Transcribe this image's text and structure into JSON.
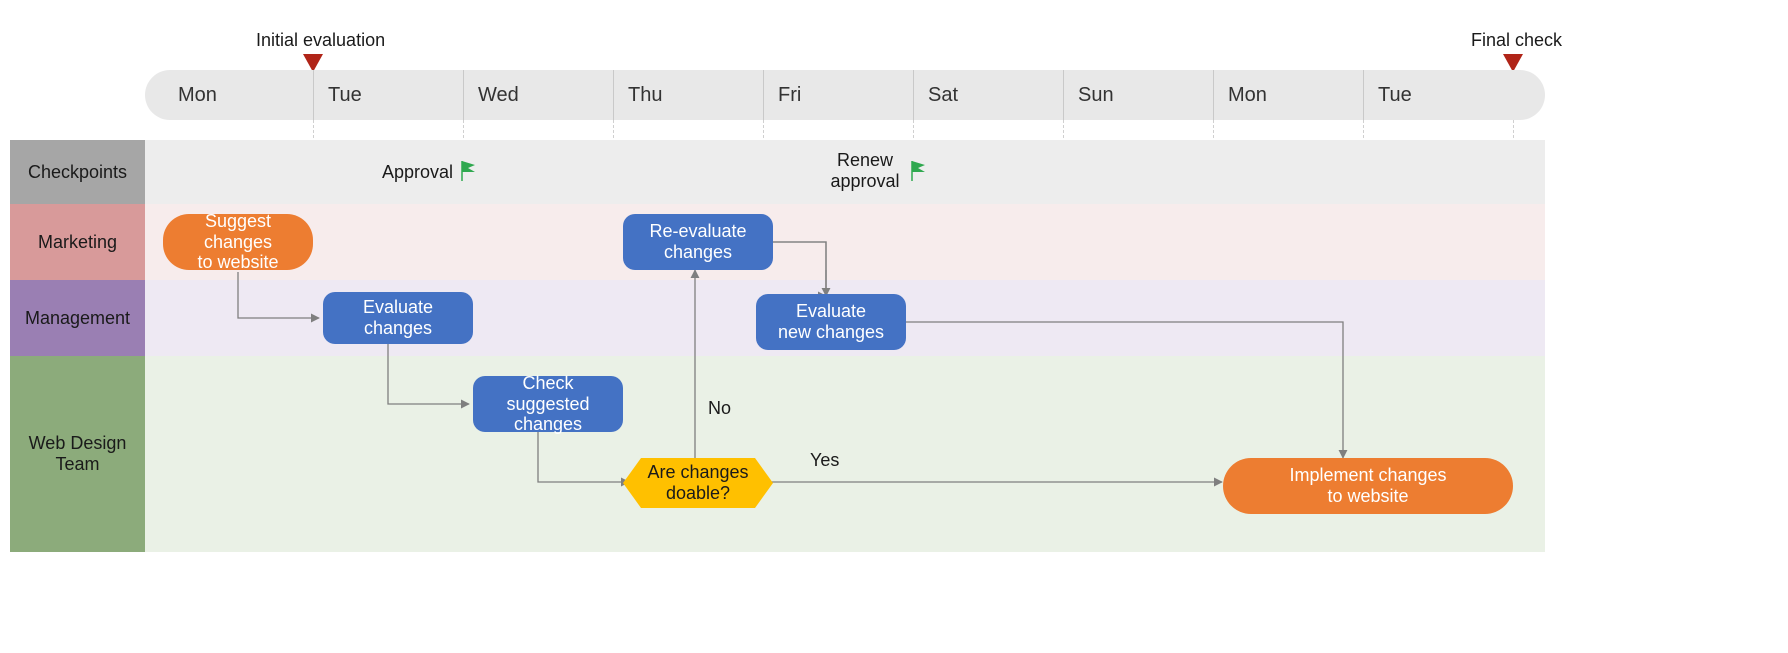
{
  "milestones": {
    "initial": "Initial evaluation",
    "final": "Final check"
  },
  "days": [
    "Mon",
    "Tue",
    "Wed",
    "Thu",
    "Fri",
    "Sat",
    "Sun",
    "Mon",
    "Tue"
  ],
  "lanes": {
    "checkpoints": "Checkpoints",
    "marketing": "Marketing",
    "management": "Management",
    "webdesign": "Web Design\nTeam"
  },
  "checkpoints": {
    "approval": "Approval",
    "renew": "Renew\napproval"
  },
  "nodes": {
    "suggest": "Suggest changes\nto website",
    "evaluate": "Evaluate changes",
    "check": "Check suggested\nchanges",
    "decision": "Are changes\ndoable?",
    "reevaluate": "Re-evaluate\nchanges",
    "evaluate_new": "Evaluate\nnew changes",
    "implement": "Implement changes\nto website"
  },
  "edge_labels": {
    "no": "No",
    "yes": "Yes"
  },
  "colors": {
    "orange": "#ed7d31",
    "blue": "#4472c4",
    "gold": "#ffc000",
    "lane_checkpoints_title": "#a6a6a6",
    "lane_checkpoints_band": "#ededed",
    "lane_marketing_title": "#d89a9a",
    "lane_marketing_band": "#f7ecec",
    "lane_management_title": "#9a7fb3",
    "lane_management_band": "#eee9f3",
    "lane_web_title": "#8cab7b",
    "lane_web_band": "#eaf1e6",
    "flag": "#2fa84f",
    "marker": "#b02418"
  },
  "chart_data": {
    "type": "swimlane-flow",
    "time_axis": [
      "Mon",
      "Tue",
      "Wed",
      "Thu",
      "Fri",
      "Sat",
      "Sun",
      "Mon",
      "Tue"
    ],
    "milestones": [
      {
        "label": "Initial evaluation",
        "at": "Tue(1)"
      },
      {
        "label": "Final check",
        "at": "Tue(2)"
      }
    ],
    "lanes": [
      "Checkpoints",
      "Marketing",
      "Management",
      "Web Design Team"
    ],
    "checkpoint_flags": [
      {
        "label": "Approval",
        "lane": "Checkpoints",
        "near_day": "Wed"
      },
      {
        "label": "Renew approval",
        "lane": "Checkpoints",
        "near_day": "Sat"
      }
    ],
    "nodes": [
      {
        "id": "suggest",
        "label": "Suggest changes to website",
        "lane": "Marketing",
        "day": "Mon",
        "shape": "rounded-rect",
        "color": "orange"
      },
      {
        "id": "evaluate",
        "label": "Evaluate changes",
        "lane": "Management",
        "day": "Tue",
        "shape": "rounded-rect",
        "color": "blue"
      },
      {
        "id": "check",
        "label": "Check suggested changes",
        "lane": "Web Design Team",
        "day": "Wed",
        "shape": "rounded-rect",
        "color": "blue"
      },
      {
        "id": "decision",
        "label": "Are changes doable?",
        "lane": "Web Design Team",
        "day": "Thu",
        "shape": "hexagon",
        "color": "gold"
      },
      {
        "id": "reevaluate",
        "label": "Re-evaluate changes",
        "lane": "Marketing",
        "day": "Thu",
        "shape": "rounded-rect",
        "color": "blue"
      },
      {
        "id": "evaluate_new",
        "label": "Evaluate new changes",
        "lane": "Management",
        "day": "Fri",
        "shape": "rounded-rect",
        "color": "blue"
      },
      {
        "id": "implement",
        "label": "Implement changes to website",
        "lane": "Web Design Team",
        "day": "Tue(2)",
        "shape": "pill",
        "color": "orange"
      }
    ],
    "edges": [
      {
        "from": "suggest",
        "to": "evaluate"
      },
      {
        "from": "evaluate",
        "to": "check"
      },
      {
        "from": "check",
        "to": "decision"
      },
      {
        "from": "decision",
        "to": "reevaluate",
        "label": "No"
      },
      {
        "from": "reevaluate",
        "to": "evaluate_new"
      },
      {
        "from": "decision",
        "to": "implement",
        "label": "Yes"
      },
      {
        "from": "evaluate_new",
        "to": "implement"
      }
    ]
  }
}
